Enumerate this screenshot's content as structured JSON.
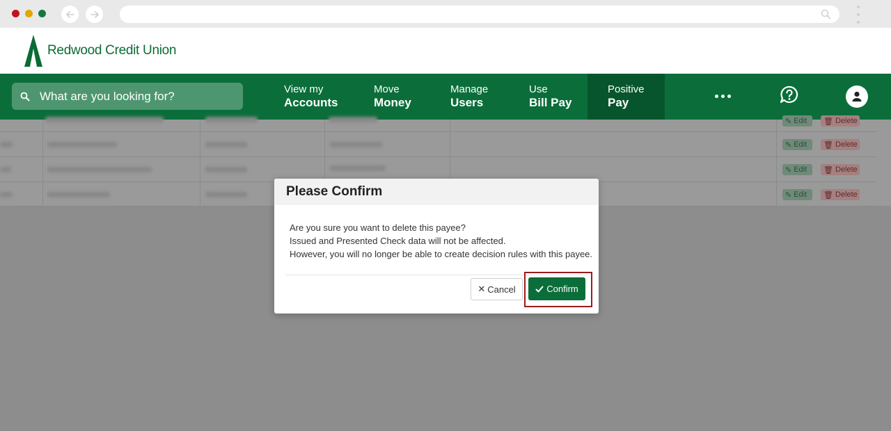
{
  "brand": {
    "name": "Redwood Credit Union",
    "primary_color": "#0b6e3a",
    "active_nav_color": "#07552c"
  },
  "search": {
    "placeholder": "What are you looking for?"
  },
  "nav": {
    "items": [
      {
        "line1": "View my",
        "line2": "Accounts",
        "active": false
      },
      {
        "line1": "Move",
        "line2": "Money",
        "active": false
      },
      {
        "line1": "Manage",
        "line2": "Users",
        "active": false
      },
      {
        "line1": "Use",
        "line2": "Bill Pay",
        "active": false
      },
      {
        "line1": "Positive",
        "line2": "Pay",
        "active": true
      }
    ],
    "icons": [
      "more-icon",
      "help-chat-icon",
      "user-avatar-icon"
    ]
  },
  "table": {
    "row_actions": {
      "edit": "Edit",
      "delete": "Delete"
    }
  },
  "modal": {
    "title": "Please Confirm",
    "lines": [
      "Are you sure you want to delete this payee?",
      "Issued and Presented Check data will not be affected.",
      "However, you will no longer be able to create decision rules with this payee."
    ],
    "cancel_label": "Cancel",
    "confirm_label": "Confirm"
  }
}
